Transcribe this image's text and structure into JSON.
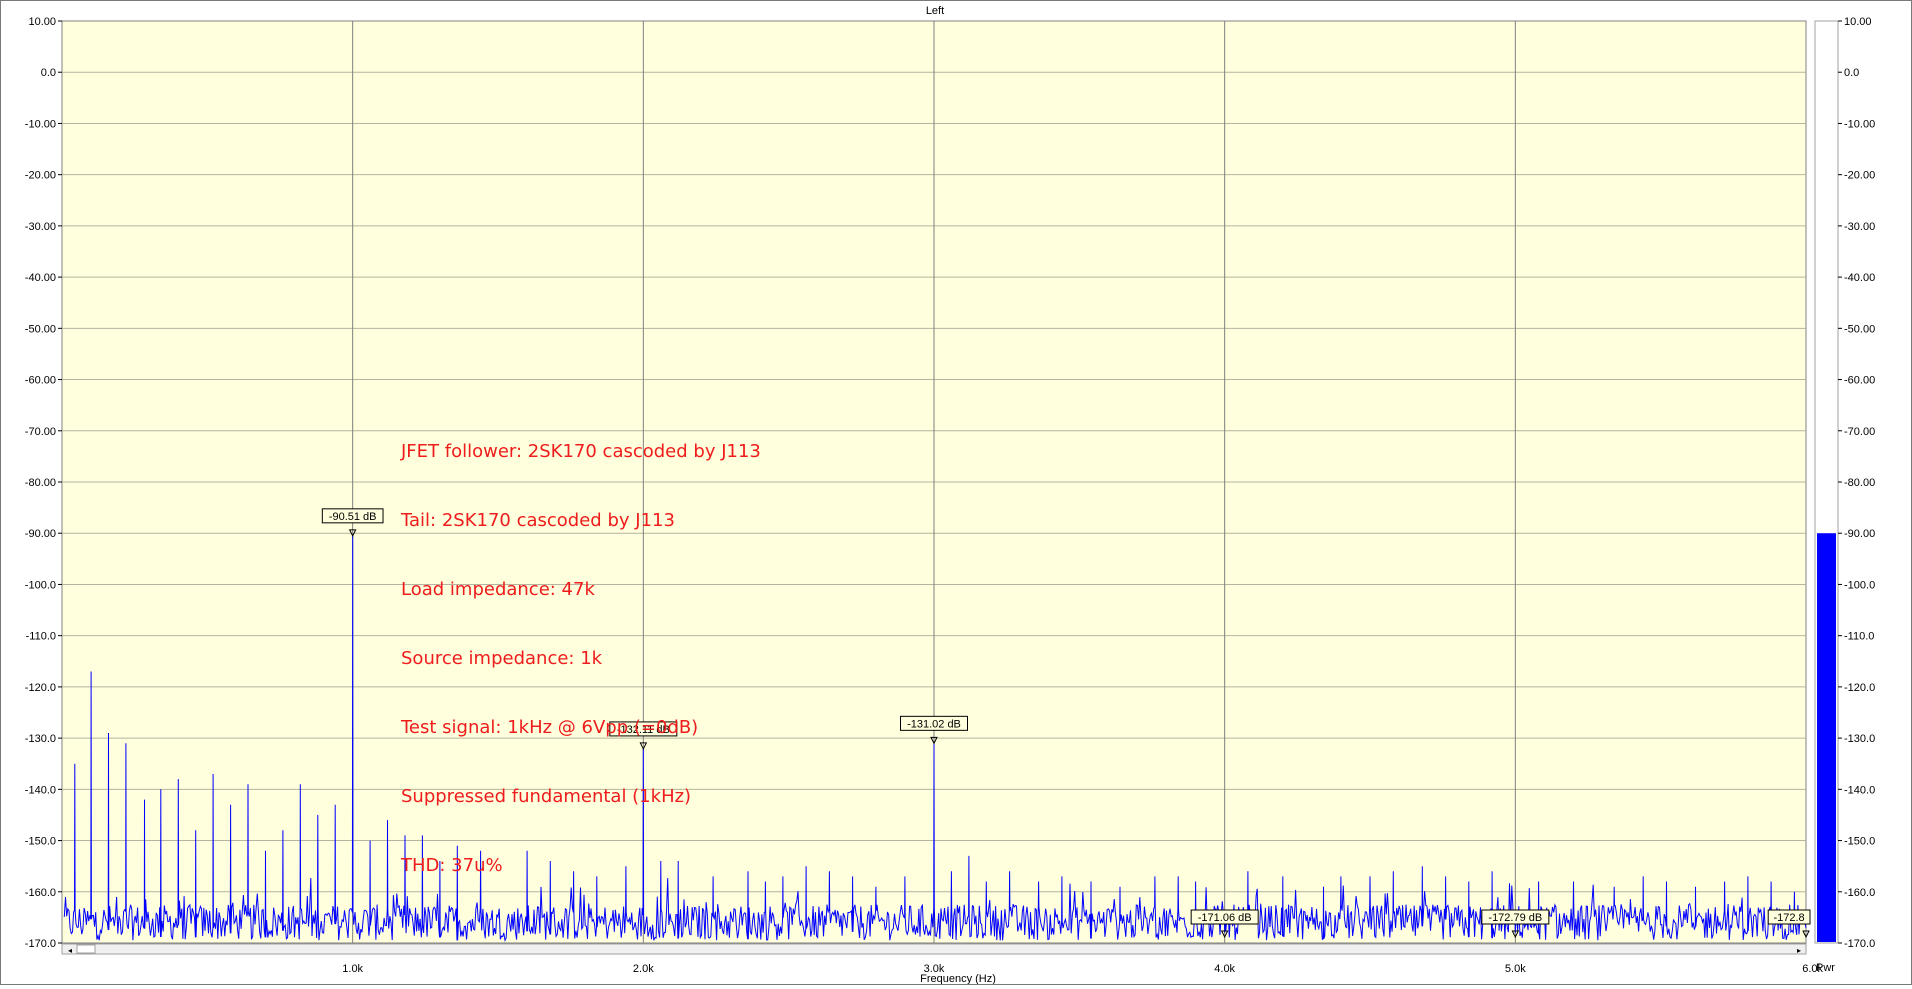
{
  "chart_data": {
    "type": "line",
    "title": "Left",
    "xlabel": "Frequency (Hz)",
    "ylabel": "",
    "xlim": [
      0,
      6000
    ],
    "ylim": [
      -170,
      10
    ],
    "x_ticks": [
      {
        "value": 1000,
        "label": "1.0k"
      },
      {
        "value": 2000,
        "label": "2.0k"
      },
      {
        "value": 3000,
        "label": "3.0k"
      },
      {
        "value": 4000,
        "label": "4.0k"
      },
      {
        "value": 5000,
        "label": "5.0k"
      },
      {
        "value": 6000,
        "label": "6.0k"
      }
    ],
    "y_ticks": [
      "10.00",
      "0.0",
      "-10.00",
      "-20.00",
      "-30.00",
      "-40.00",
      "-50.00",
      "-60.00",
      "-70.00",
      "-80.00",
      "-90.00",
      "-100.0",
      "-110.0",
      "-120.0",
      "-130.0",
      "-140.0",
      "-150.0",
      "-160.0",
      "-170.0"
    ],
    "y_tick_values": [
      10,
      0,
      -10,
      -20,
      -30,
      -40,
      -50,
      -60,
      -70,
      -80,
      -90,
      -100,
      -110,
      -120,
      -130,
      -140,
      -150,
      -160,
      -170
    ],
    "noise_floor_db": -166,
    "peaks": [
      {
        "x": 42,
        "y": -135
      },
      {
        "x": 100,
        "y": -117
      },
      {
        "x": 160,
        "y": -129
      },
      {
        "x": 220,
        "y": -131
      },
      {
        "x": 282,
        "y": -142
      },
      {
        "x": 340,
        "y": -140
      },
      {
        "x": 400,
        "y": -138
      },
      {
        "x": 460,
        "y": -148
      },
      {
        "x": 520,
        "y": -137
      },
      {
        "x": 580,
        "y": -143
      },
      {
        "x": 640,
        "y": -139
      },
      {
        "x": 700,
        "y": -152
      },
      {
        "x": 760,
        "y": -148
      },
      {
        "x": 820,
        "y": -139
      },
      {
        "x": 880,
        "y": -145
      },
      {
        "x": 940,
        "y": -143
      },
      {
        "x": 1000,
        "y": -90.51
      },
      {
        "x": 1060,
        "y": -150
      },
      {
        "x": 1120,
        "y": -146
      },
      {
        "x": 1180,
        "y": -149
      },
      {
        "x": 1240,
        "y": -149
      },
      {
        "x": 1300,
        "y": -154
      },
      {
        "x": 1360,
        "y": -151
      },
      {
        "x": 1440,
        "y": -152
      },
      {
        "x": 1600,
        "y": -152
      },
      {
        "x": 1680,
        "y": -154
      },
      {
        "x": 1760,
        "y": -156
      },
      {
        "x": 1840,
        "y": -157
      },
      {
        "x": 1940,
        "y": -155
      },
      {
        "x": 2000,
        "y": -132.11
      },
      {
        "x": 2060,
        "y": -154
      },
      {
        "x": 2120,
        "y": -154
      },
      {
        "x": 2240,
        "y": -157
      },
      {
        "x": 2360,
        "y": -156
      },
      {
        "x": 2420,
        "y": -158
      },
      {
        "x": 2480,
        "y": -157
      },
      {
        "x": 2560,
        "y": -155
      },
      {
        "x": 2640,
        "y": -156
      },
      {
        "x": 2720,
        "y": -157
      },
      {
        "x": 2800,
        "y": -159
      },
      {
        "x": 2900,
        "y": -157
      },
      {
        "x": 3000,
        "y": -131.02
      },
      {
        "x": 3060,
        "y": -156
      },
      {
        "x": 3120,
        "y": -153
      },
      {
        "x": 3180,
        "y": -158
      },
      {
        "x": 3260,
        "y": -156
      },
      {
        "x": 3360,
        "y": -158
      },
      {
        "x": 3440,
        "y": -157
      },
      {
        "x": 3540,
        "y": -158
      },
      {
        "x": 3640,
        "y": -159
      },
      {
        "x": 3760,
        "y": -157
      },
      {
        "x": 3840,
        "y": -157
      },
      {
        "x": 3900,
        "y": -158
      },
      {
        "x": 4000,
        "y": -171.06
      },
      {
        "x": 4080,
        "y": -156
      },
      {
        "x": 4200,
        "y": -157
      },
      {
        "x": 4340,
        "y": -159
      },
      {
        "x": 4400,
        "y": -157
      },
      {
        "x": 4500,
        "y": -157
      },
      {
        "x": 4580,
        "y": -156
      },
      {
        "x": 4680,
        "y": -155
      },
      {
        "x": 4760,
        "y": -157
      },
      {
        "x": 4840,
        "y": -158
      },
      {
        "x": 4920,
        "y": -156
      },
      {
        "x": 5000,
        "y": -172.79
      },
      {
        "x": 5080,
        "y": -158
      },
      {
        "x": 5200,
        "y": -158
      },
      {
        "x": 5340,
        "y": -159
      },
      {
        "x": 5440,
        "y": -157
      },
      {
        "x": 5520,
        "y": -158
      },
      {
        "x": 5620,
        "y": -159
      },
      {
        "x": 5720,
        "y": -158
      },
      {
        "x": 5800,
        "y": -157
      },
      {
        "x": 5880,
        "y": -158
      },
      {
        "x": 5960,
        "y": -160
      }
    ],
    "markers": [
      {
        "x": 1000,
        "y": -90.51,
        "label": "-90.51 dB"
      },
      {
        "x": 2000,
        "y": -132.11,
        "label": "-132.11 dB"
      },
      {
        "x": 3000,
        "y": -131.02,
        "label": "-131.02 dB"
      },
      {
        "x": 4000,
        "y": -171.06,
        "label": "-171.06 dB"
      },
      {
        "x": 5000,
        "y": -172.79,
        "label": "-172.79 dB"
      },
      {
        "x": 6000,
        "y": -172.8,
        "label": "-172.8"
      }
    ],
    "grid": true,
    "line_color": "#0000ff",
    "plot_bg": "#ffffdd",
    "annotation_color": "#ee1c1c",
    "meter": {
      "unit_label": "Pwr",
      "value_db": -90,
      "ylim": [
        -170,
        10
      ],
      "fill_color": "#0000ff"
    }
  },
  "annotation_lines": [
    "JFET follower: 2SK170 cascoded by J113",
    "Tail: 2SK170 cascoded by J113",
    "Load impedance: 47k",
    "Source impedance: 1k",
    "Test signal: 1kHz @ 6Vpp (=0dB)",
    "Suppressed fundamental (1kHz)",
    "THD: 37u%"
  ]
}
